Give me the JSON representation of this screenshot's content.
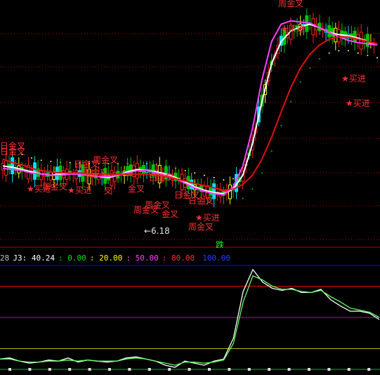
{
  "colors": {
    "background": "#000000",
    "grid_red": "#c00000",
    "up_candle": "#ff2020",
    "down_candle": "#00c000",
    "neutral_candle": "#00e0ff",
    "yellow": "#ffff00",
    "ma_white": "#ffffff",
    "ma_magenta": "#ff40ff",
    "ma_red_long": "#e01010",
    "dots_green": "#00c000",
    "dots_yellow": "#ffff66",
    "ind_j": "#ffffff",
    "ind_signal": "#60ff60",
    "ind_blue": "#0000ff",
    "ind_red": "#ff0000",
    "ind_magenta": "#c000c0",
    "ind_yellow": "#c8c800",
    "label_red": "#ff3030",
    "label_white": "#e0e0e0",
    "label_green": "#00ff00"
  },
  "indicator_header": {
    "prefix": "28",
    "j3_label": "J3: 40.24",
    "lvl0": ": 0.00",
    "lvl20": ": 20.00",
    "lvl50": ": 50.00",
    "lvl80": ": 80.00",
    "lvl100": "100.00"
  },
  "annotations": [
    {
      "text": "日金叉",
      "color": "label_red"
    },
    {
      "text": "日金叉",
      "color": "label_red"
    },
    {
      "text": "周金叉",
      "color": "label_red"
    },
    {
      "text": "日金叉",
      "color": "label_red"
    },
    {
      "text": "日金叉",
      "color": "label_red"
    },
    {
      "text": "周金叉",
      "color": "label_red"
    },
    {
      "text": "金叉",
      "color": "label_red"
    },
    {
      "text": "周金叉",
      "color": "label_red"
    },
    {
      "text": "叉",
      "color": "label_red"
    },
    {
      "text": "日金叉",
      "color": "label_red"
    },
    {
      "text": "周金叉",
      "color": "label_red"
    },
    {
      "text": "日金叉",
      "color": "label_red"
    },
    {
      "text": "周金叉",
      "color": "label_red"
    },
    {
      "text": "周金叉",
      "color": "label_red"
    },
    {
      "text": "金叉",
      "color": "label_red"
    },
    {
      "text": "周金叉",
      "color": "label_red"
    },
    {
      "text": "★买进",
      "color": "label_red"
    },
    {
      "text": "★买进",
      "color": "label_red"
    },
    {
      "text": "★买进",
      "color": "label_red"
    },
    {
      "text": "★买进",
      "color": "label_red"
    },
    {
      "text": "★买进",
      "color": "label_red"
    },
    {
      "text": "★买进",
      "color": "label_red"
    },
    {
      "text": "←6.18",
      "color": "label_white"
    },
    {
      "text": "跌",
      "color": "label_green"
    }
  ],
  "chart_data": [
    {
      "type": "candlestick",
      "title": "",
      "price_low_label": "6.18",
      "series": [
        {
          "name": "",
          "role": "ma-white",
          "values": [
            12.6,
            12.5,
            12.3,
            12.1,
            11.9,
            11.8,
            11.9,
            12.0,
            11.9,
            11.8,
            11.7,
            11.6,
            11.8,
            12.1,
            12.3,
            12.2,
            12.1,
            11.9,
            11.6,
            11.2,
            10.8,
            10.5,
            10.3,
            10.2,
            10.6,
            11.8,
            14.5,
            18.2,
            21.5,
            23.4,
            24.3,
            24.7,
            24.9,
            24.6,
            24.2,
            24.0,
            23.9,
            23.7,
            23.4,
            23.1
          ]
        },
        {
          "name": "",
          "role": "ma-magenta",
          "values": [
            12.4,
            12.3,
            12.2,
            12.0,
            11.9,
            11.8,
            11.8,
            11.9,
            11.9,
            11.8,
            11.7,
            11.7,
            11.8,
            12.0,
            12.2,
            12.2,
            12.0,
            11.8,
            11.5,
            11.1,
            10.7,
            10.4,
            10.2,
            10.1,
            10.8,
            12.6,
            15.8,
            20.1,
            23.4,
            24.9,
            25.2,
            25.1,
            25.0,
            24.6,
            24.2,
            23.8,
            23.5,
            23.3,
            23.2,
            23.1
          ]
        },
        {
          "name": "",
          "role": "ma-red-long",
          "values": [
            13.2,
            12.9,
            12.7,
            12.4,
            12.2,
            12.1,
            12.0,
            12.0,
            12.0,
            11.9,
            11.9,
            11.9,
            11.9,
            11.9,
            11.9,
            11.9,
            11.8,
            11.7,
            11.5,
            11.3,
            11.1,
            10.9,
            10.7,
            10.5,
            10.6,
            11.0,
            11.8,
            13.2,
            15.1,
            17.3,
            19.4,
            21.1,
            22.3,
            23.1,
            23.6,
            23.8,
            23.8,
            23.6,
            23.4,
            23.2
          ]
        }
      ]
    },
    {
      "type": "line",
      "title": "",
      "ylim": [
        0,
        100
      ],
      "levels": [
        0,
        20,
        50,
        80,
        100
      ],
      "series": [
        {
          "name": "J3",
          "values": [
            10,
            11,
            8,
            6,
            7,
            9,
            8,
            11,
            7,
            9,
            8,
            7,
            8,
            11,
            12,
            10,
            8,
            4,
            2,
            8,
            6,
            4,
            8,
            10,
            30,
            75,
            96,
            84,
            78,
            76,
            78,
            74,
            74,
            77,
            67,
            61,
            56,
            56,
            54,
            48
          ]
        },
        {
          "name": "",
          "values": [
            10,
            10,
            8,
            7,
            7,
            8,
            8,
            9,
            8,
            9,
            8,
            8,
            8,
            10,
            11,
            10,
            8,
            6,
            4,
            7,
            7,
            6,
            7,
            9,
            25,
            65,
            90,
            86,
            80,
            77,
            77,
            75,
            74,
            76,
            70,
            65,
            59,
            57,
            55,
            50
          ]
        }
      ]
    }
  ]
}
